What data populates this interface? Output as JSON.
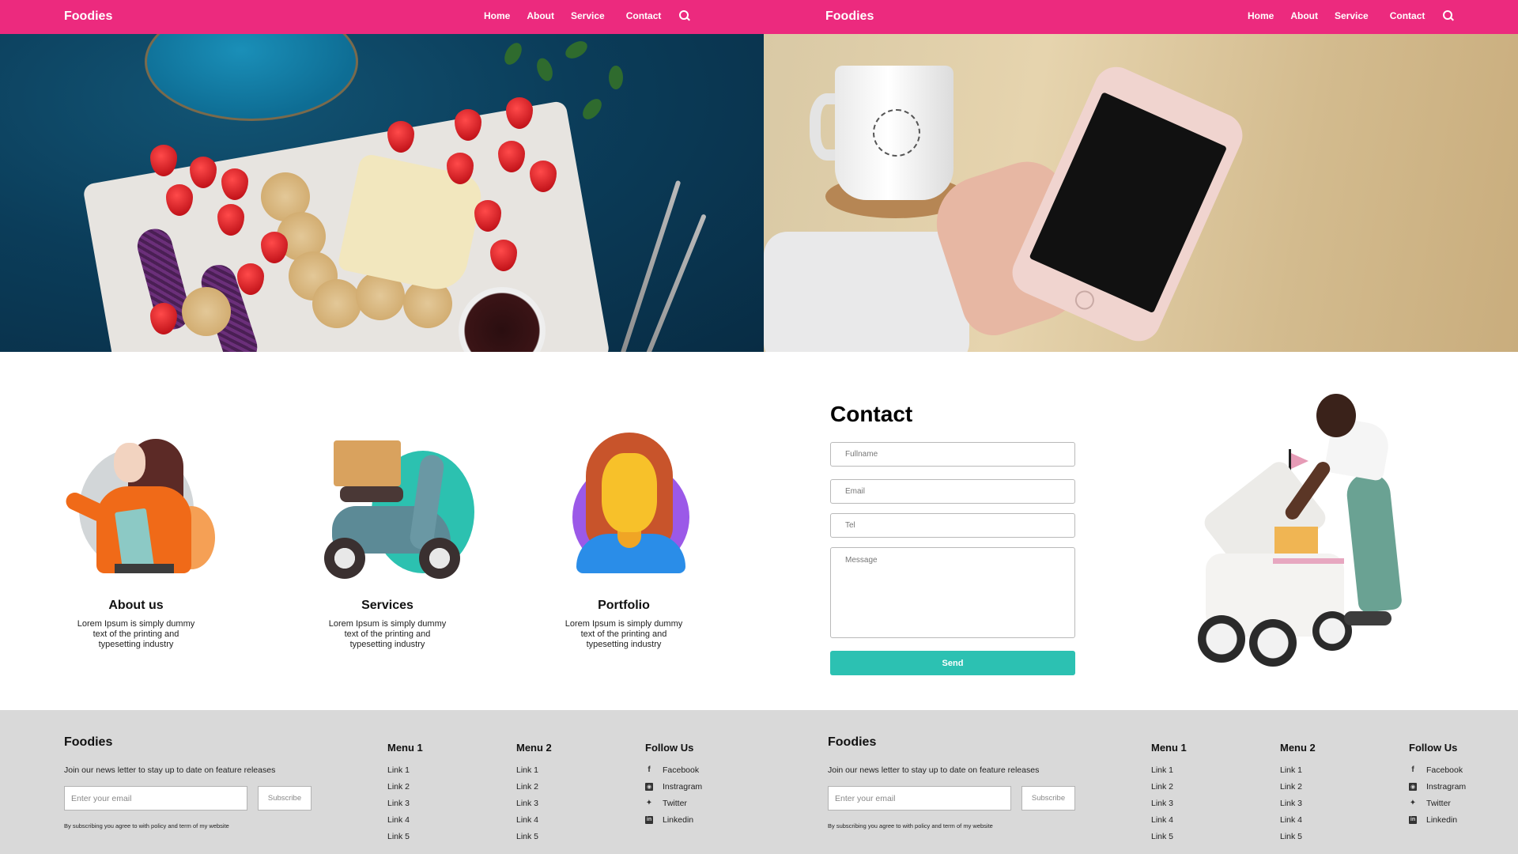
{
  "nav": {
    "brand": "Foodies",
    "links": [
      "Home",
      "About",
      "Service",
      "Contact"
    ],
    "search_icon": "search-icon",
    "color": "#ec2a7e"
  },
  "hero": {
    "left_image": "food-platter-photo",
    "right_image": "hand-holding-phone-photo"
  },
  "services": [
    {
      "title": "About us",
      "description": "Lorem Ipsum is simply dummy text of the printing and typesetting industry",
      "illustration": "woman-with-clipboard"
    },
    {
      "title": "Services",
      "description": "Lorem Ipsum is simply dummy text of the printing and typesetting industry",
      "illustration": "delivery-scooter"
    },
    {
      "title": "Portfolio",
      "description": "Lorem Ipsum is simply dummy text of the printing and typesetting industry",
      "illustration": "user-avatar"
    }
  ],
  "contact": {
    "title": "Contact",
    "fullname_placeholder": "Fullname",
    "email_placeholder": "Email",
    "tel_placeholder": "Tel",
    "message_placeholder": "Message",
    "send_label": "Send",
    "accent": "#2cc1b2",
    "illustration": "woman-with-delivery-robot"
  },
  "footer": {
    "brand": "Foodies",
    "newsletter_text": "Join our news letter to stay up to date on feature releases",
    "email_placeholder": "Enter your email",
    "subscribe_label": "Subscribe",
    "legal": "By subscribing you agree to with policy and term of my website",
    "menu1": {
      "title": "Menu 1",
      "links": [
        "Link 1",
        "Link 2",
        "Link 3",
        "Link 4",
        "Link 5"
      ]
    },
    "menu2": {
      "title": "Menu 2",
      "links": [
        "Link 1",
        "Link 2",
        "Link 3",
        "Link 4",
        "Link 5"
      ]
    },
    "follow": {
      "title": "Follow Us",
      "items": [
        {
          "label": "Facebook",
          "icon": "f"
        },
        {
          "label": "Instragram",
          "icon": "◘"
        },
        {
          "label": "Twitter",
          "icon": "🐦"
        },
        {
          "label": "Linkedin",
          "icon": "in"
        }
      ]
    },
    "background": "#d9d9d9"
  }
}
